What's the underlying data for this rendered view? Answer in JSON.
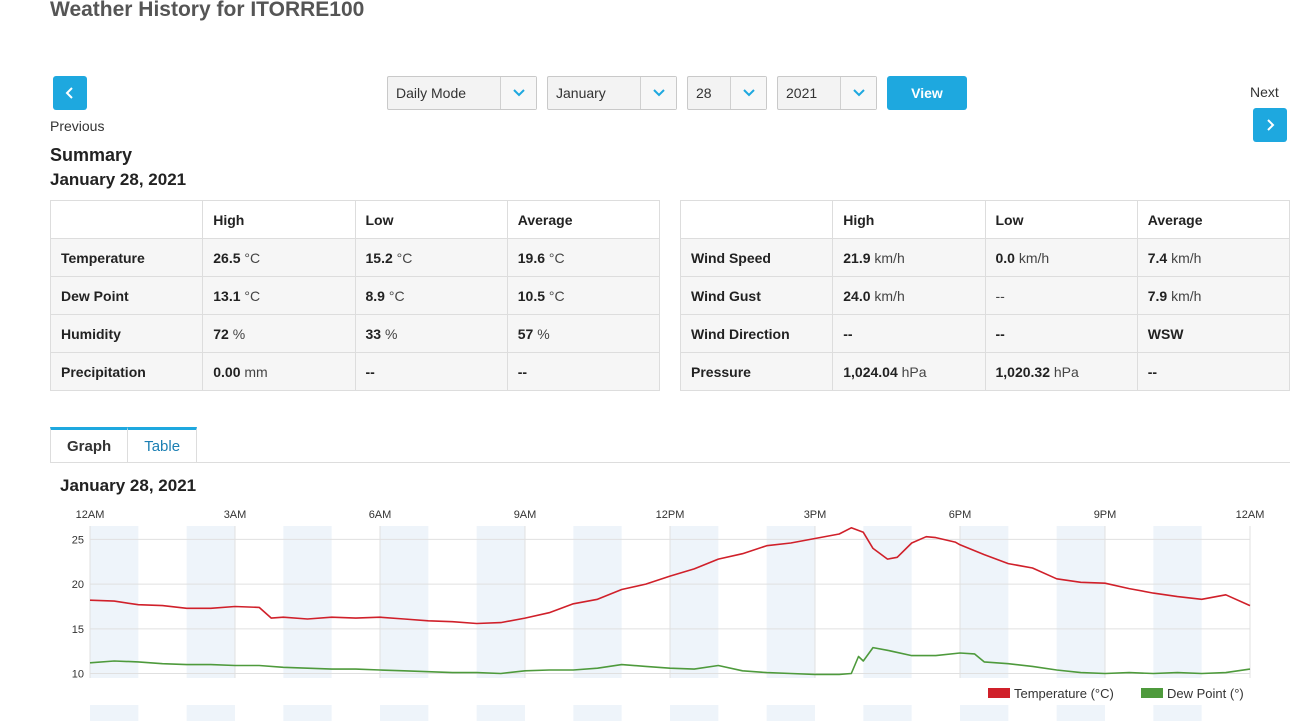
{
  "page": {
    "title": "Weather History for ITORRE100"
  },
  "nav": {
    "previous_label": "Previous",
    "next_label": "Next"
  },
  "controls": {
    "mode": "Daily Mode",
    "month": "January",
    "day": "28",
    "year": "2021",
    "view_label": "View"
  },
  "summary": {
    "heading": "Summary",
    "date": "January 28, 2021",
    "left_table": {
      "headers": [
        "",
        "High",
        "Low",
        "Average"
      ],
      "rows": [
        {
          "label": "Temperature",
          "cells": [
            {
              "v": "26.5",
              "u": "°C"
            },
            {
              "v": "15.2",
              "u": "°C"
            },
            {
              "v": "19.6",
              "u": "°C"
            }
          ]
        },
        {
          "label": "Dew Point",
          "cells": [
            {
              "v": "13.1",
              "u": "°C"
            },
            {
              "v": "8.9",
              "u": "°C"
            },
            {
              "v": "10.5",
              "u": "°C"
            }
          ]
        },
        {
          "label": "Humidity",
          "cells": [
            {
              "v": "72",
              "u": "%"
            },
            {
              "v": "33",
              "u": "%"
            },
            {
              "v": "57",
              "u": "%"
            }
          ]
        },
        {
          "label": "Precipitation",
          "cells": [
            {
              "v": "0.00",
              "u": "mm"
            },
            {
              "v": "--",
              "u": ""
            },
            {
              "v": "--",
              "u": ""
            }
          ]
        }
      ]
    },
    "right_table": {
      "headers": [
        "",
        "High",
        "Low",
        "Average"
      ],
      "rows": [
        {
          "label": "Wind Speed",
          "cells": [
            {
              "v": "21.9",
              "u": "km/h"
            },
            {
              "v": "0.0",
              "u": "km/h"
            },
            {
              "v": "7.4",
              "u": "km/h"
            }
          ]
        },
        {
          "label": "Wind Gust",
          "cells": [
            {
              "v": "24.0",
              "u": "km/h"
            },
            {
              "v": "--",
              "u": ""
            },
            {
              "v": "7.9",
              "u": "km/h"
            }
          ]
        },
        {
          "label": "Wind Direction",
          "cells": [
            {
              "v": "--",
              "u": ""
            },
            {
              "v": "--",
              "u": ""
            },
            {
              "v": "WSW",
              "u": ""
            }
          ]
        },
        {
          "label": "Pressure",
          "cells": [
            {
              "v": "1,024.04",
              "u": "hPa"
            },
            {
              "v": "1,020.32",
              "u": "hPa"
            },
            {
              "v": "--",
              "u": ""
            }
          ]
        }
      ]
    }
  },
  "tabs": [
    {
      "label": "Graph",
      "active": true
    },
    {
      "label": "Table",
      "active": false
    }
  ],
  "graph": {
    "date": "January 28, 2021"
  },
  "colors": {
    "accent": "#1ea8df",
    "temperature": "#d0202a",
    "dew_point": "#4e9a3c",
    "band": "#eef4fa"
  },
  "chart_data": {
    "type": "line",
    "x": [
      "12AM",
      "3AM",
      "6AM",
      "9AM",
      "12PM",
      "3PM",
      "6PM",
      "9PM",
      "12AM"
    ],
    "ylim": [
      9.5,
      26.5
    ],
    "yticks": [
      10,
      15,
      20,
      25
    ],
    "legend_position": "bottom-right",
    "grid": true,
    "series": [
      {
        "name": "Temperature (°C)",
        "hours": [
          0,
          0.5,
          1,
          1.5,
          2,
          2.5,
          3,
          3.5,
          3.75,
          4,
          4.5,
          5,
          5.5,
          6,
          6.5,
          7,
          7.5,
          8,
          8.5,
          9,
          9.5,
          10,
          10.5,
          11,
          11.5,
          12,
          12.5,
          13,
          13.5,
          14,
          14.5,
          15,
          15.5,
          15.75,
          16,
          16.2,
          16.5,
          16.7,
          17,
          17.3,
          17.5,
          17.9,
          18,
          18.5,
          19,
          19.5,
          20,
          20.5,
          21,
          21.5,
          22,
          22.5,
          23,
          23.5,
          24
        ],
        "values": [
          18.2,
          18.1,
          17.7,
          17.6,
          17.3,
          17.3,
          17.5,
          17.4,
          16.2,
          16.3,
          16.1,
          16.3,
          16.2,
          16.3,
          16.1,
          15.9,
          15.8,
          15.6,
          15.7,
          16.2,
          16.8,
          17.8,
          18.3,
          19.4,
          20.0,
          20.9,
          21.7,
          22.8,
          23.4,
          24.3,
          24.6,
          25.1,
          25.6,
          26.3,
          25.8,
          24.0,
          22.8,
          23.0,
          24.6,
          25.3,
          25.2,
          24.7,
          24.4,
          23.3,
          22.3,
          21.8,
          20.6,
          20.2,
          20.1,
          19.5,
          19.0,
          18.6,
          18.3,
          18.8,
          17.6
        ]
      },
      {
        "name": "Dew Point (°)",
        "hours": [
          0,
          0.5,
          1,
          1.5,
          2,
          2.5,
          3,
          3.5,
          4,
          4.5,
          5,
          5.5,
          6,
          6.5,
          7,
          7.5,
          8,
          8.5,
          9,
          9.5,
          10,
          10.5,
          11,
          11.5,
          12,
          12.5,
          13,
          13.5,
          14,
          14.5,
          15,
          15.5,
          15.75,
          15.9,
          16,
          16.2,
          16.5,
          17,
          17.5,
          18,
          18.3,
          18.5,
          19,
          19.5,
          20,
          20.5,
          21,
          21.5,
          22,
          22.5,
          23,
          23.5,
          24
        ],
        "values": [
          11.2,
          11.4,
          11.3,
          11.1,
          11.0,
          11.0,
          10.9,
          10.9,
          10.7,
          10.6,
          10.5,
          10.5,
          10.4,
          10.3,
          10.2,
          10.1,
          10.1,
          10.0,
          10.3,
          10.4,
          10.4,
          10.6,
          11.0,
          10.8,
          10.6,
          10.5,
          10.9,
          10.3,
          10.1,
          10.0,
          9.9,
          9.9,
          10.0,
          11.9,
          11.4,
          12.9,
          12.6,
          12.0,
          12.0,
          12.3,
          12.2,
          11.3,
          11.1,
          10.8,
          10.4,
          10.1,
          10.0,
          10.1,
          10.0,
          10.1,
          10.0,
          10.1,
          10.5
        ]
      }
    ]
  }
}
